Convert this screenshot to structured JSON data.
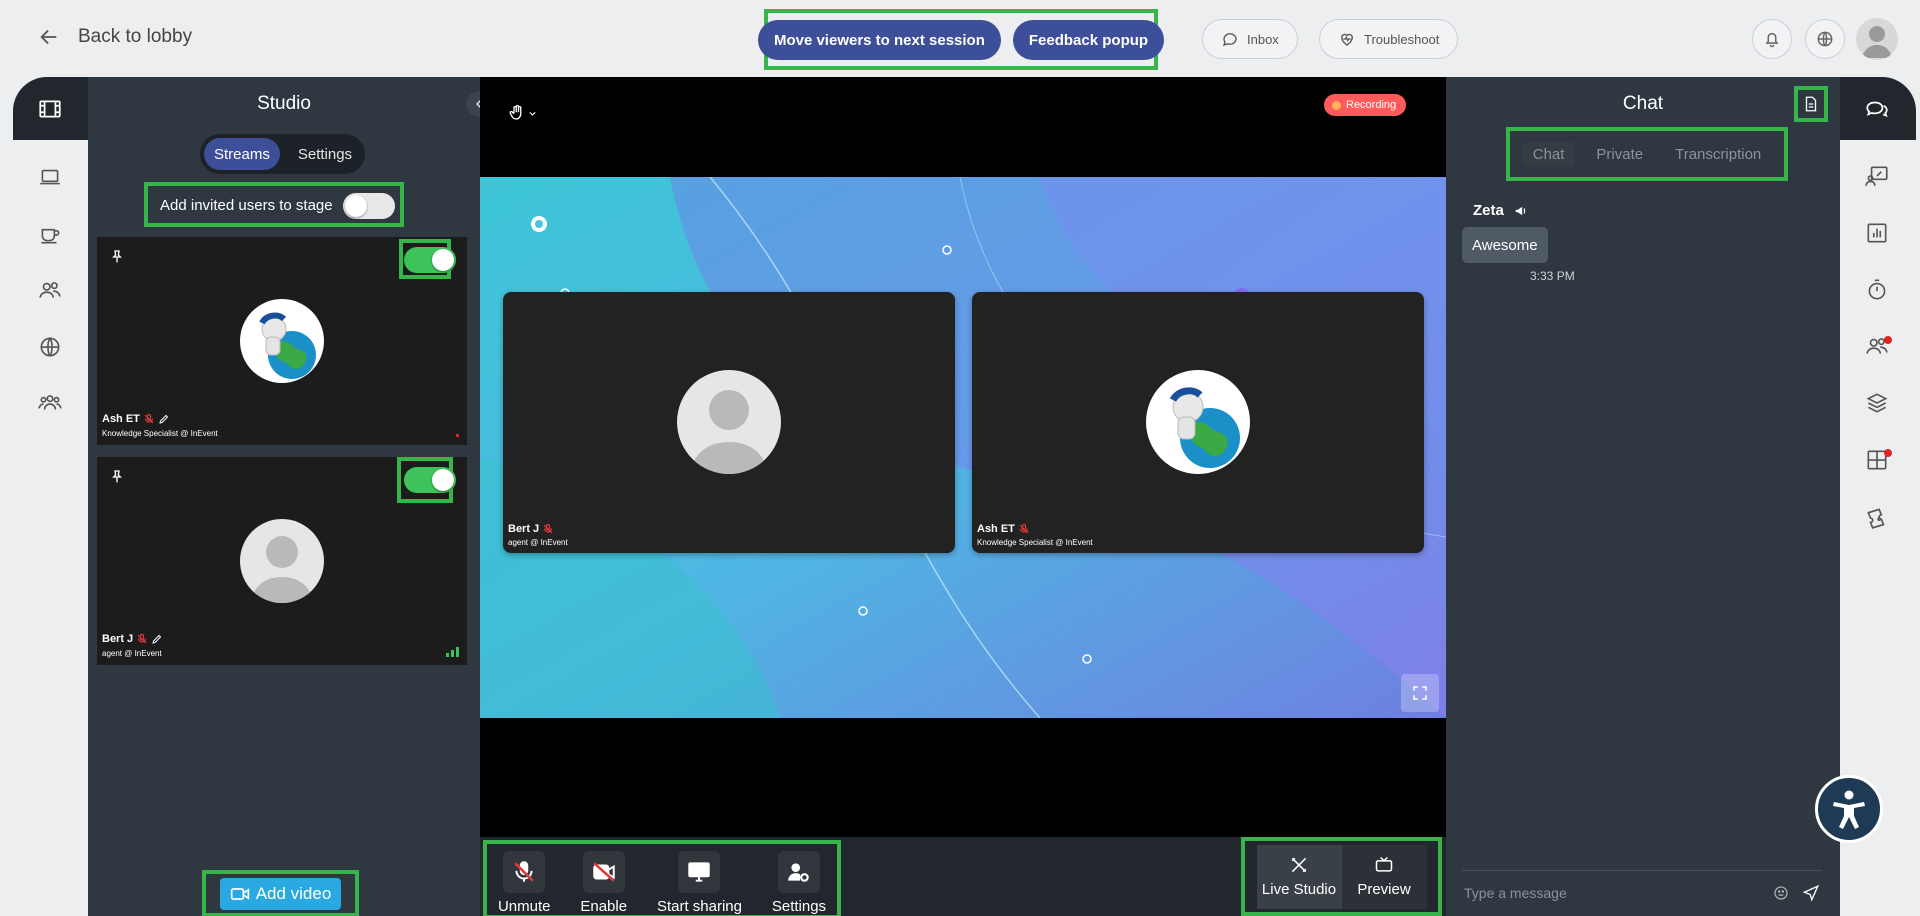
{
  "topbar": {
    "back_label": "Back to lobby",
    "move_viewers_label": "Move viewers to next session",
    "feedback_label": "Feedback popup",
    "inbox_label": "Inbox",
    "troubleshoot_label": "Troubleshoot"
  },
  "studio": {
    "title": "Studio",
    "tabs": [
      {
        "label": "Streams",
        "active": true
      },
      {
        "label": "Settings",
        "active": false
      }
    ],
    "invite_label": "Add invited users to stage",
    "invite_enabled": false,
    "streams": [
      {
        "name": "Ash ET",
        "subtitle": "Knowledge Specialist @ InEvent",
        "on_stage": true,
        "avatar": "earth-astronaut"
      },
      {
        "name": "Bert J",
        "subtitle": "agent @ InEvent",
        "on_stage": true,
        "avatar": "default-user"
      }
    ],
    "add_video_label": "Add video"
  },
  "stage": {
    "recording_label": "Recording",
    "tiles": [
      {
        "name": "Bert J",
        "subtitle": "agent @ InEvent",
        "avatar": "default-user"
      },
      {
        "name": "Ash ET",
        "subtitle": "Knowledge Specialist @ InEvent",
        "avatar": "earth-astronaut"
      }
    ],
    "controls": {
      "unmute_label": "Unmute",
      "enable_label": "Enable",
      "share_label": "Start sharing",
      "settings_label": "Settings"
    },
    "modes": {
      "live_label": "Live Studio",
      "preview_label": "Preview"
    }
  },
  "chat": {
    "title": "Chat",
    "tabs": [
      "Chat",
      "Private",
      "Transcription"
    ],
    "active_tab": "Chat",
    "messages": [
      {
        "author": "Zeta",
        "text": "Awesome",
        "time": "3:33 PM"
      }
    ],
    "input_placeholder": "Type a message"
  },
  "colors": {
    "accent": "#3e4f99",
    "highlight": "#38b54a",
    "toggle_on": "#3ec35a",
    "recording": "#ff5a5a",
    "add_video": "#2aa8e0"
  }
}
